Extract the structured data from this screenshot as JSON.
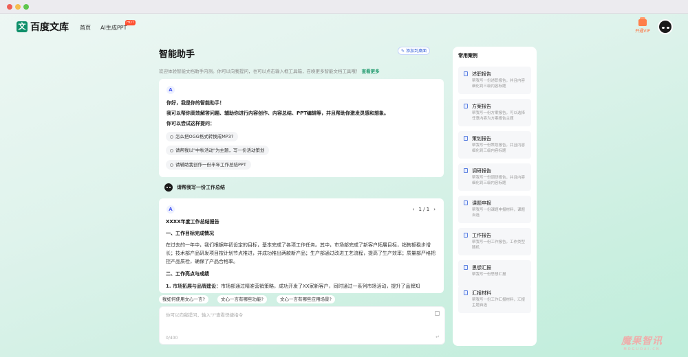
{
  "app": {
    "logo_mark": "文",
    "logo_text": "百度文库",
    "nav": [
      {
        "label": "首页"
      },
      {
        "label": "AI生成PPT"
      }
    ],
    "hot_badge": "HOT",
    "vip_label": "开通VIP"
  },
  "header": {
    "title": "智能助手",
    "pin_button": "添加到桌面",
    "welcome_text": "欢迎体验智能文档助手内测。你可以向我提问，也可以点击输入框工具箱，召唤更多智能文档工具哦！",
    "welcome_more": "查看更多"
  },
  "intro": {
    "bot_icon_glyph": "A",
    "lines": [
      "你好，我是你的智能助手！",
      "我可以帮你高效解答问题、辅助你进行内容创作、内容总结、PPT编辑等，并且帮助你激发灵感和想象。",
      "你可以尝试这样提问："
    ],
    "suggestions": [
      "怎么把OGG格式转换成MP3?",
      "请帮我以\"中秋活动\"为主题，写一份活动策划",
      "请辅助我创作一份半年工作总结PPT"
    ]
  },
  "user_message": "请帮我写一份工作总结",
  "report": {
    "pager": {
      "prev": "‹",
      "text": "1 / 1",
      "next": "›"
    },
    "title": "XXXX年度工作总结报告",
    "section1": "一、工作目标完成情况",
    "para1": "在过去的一年中，我们根据年初设定的目标，基本完成了各项工作任务。其中，市场部完成了新客户拓展目标，销售额稳步增长；技术部产品研发项目按计划节点推进，并成功推出两款新产品；生产部通过改进工艺流程，提高了生产效率；质量部严格把控产品质检，确保了产品合格率。",
    "section2": "二、工作亮点与成绩",
    "item1_bold": "1. 市场拓展与品牌建设：",
    "item1_text": "市场部通过精准营销策略，成功开发了XX家新客户，同时通过一系列市场活动，提升了品牌知"
  },
  "quick_chips": [
    "我如何使用文心一言?",
    "文心一言有哪些功能?",
    "文心一言有哪些应用场景?"
  ],
  "input": {
    "placeholder": "你可以向我提问，输入\"/\"查看快捷指令",
    "count": "0/400",
    "enter_glyph": "↵"
  },
  "sidebar": {
    "title": "常用案例",
    "cases": [
      {
        "title": "述职报告",
        "desc": "帮我写一份述职报告，并且内容细化到三级内容标题"
      },
      {
        "title": "方案报告",
        "desc": "帮我写一份方案报告，可以选择任意内容为方案报告主题"
      },
      {
        "title": "策划报告",
        "desc": "帮我写一份策划报告，并且内容细化到三级内容标题"
      },
      {
        "title": "调研报告",
        "desc": "帮我写一份调研报告，并且内容细化到三级内容标题"
      },
      {
        "title": "课题申报",
        "desc": "帮我写一份课题申报材料，课题自选"
      },
      {
        "title": "工作报告",
        "desc": "帮我写一份工作报告，工作类型随机"
      },
      {
        "title": "思想汇报",
        "desc": "帮我写一份思想汇报"
      },
      {
        "title": "汇报材料",
        "desc": "帮我写一份工作汇报材料，汇报主题自选"
      }
    ]
  },
  "watermark": {
    "cn": "魔果智讯",
    "en": "MOGUOAI.CN"
  },
  "colors": {
    "accent": "#1f9a6d",
    "link_blue": "#2e5bd6",
    "vip_orange": "#ff6b35"
  }
}
